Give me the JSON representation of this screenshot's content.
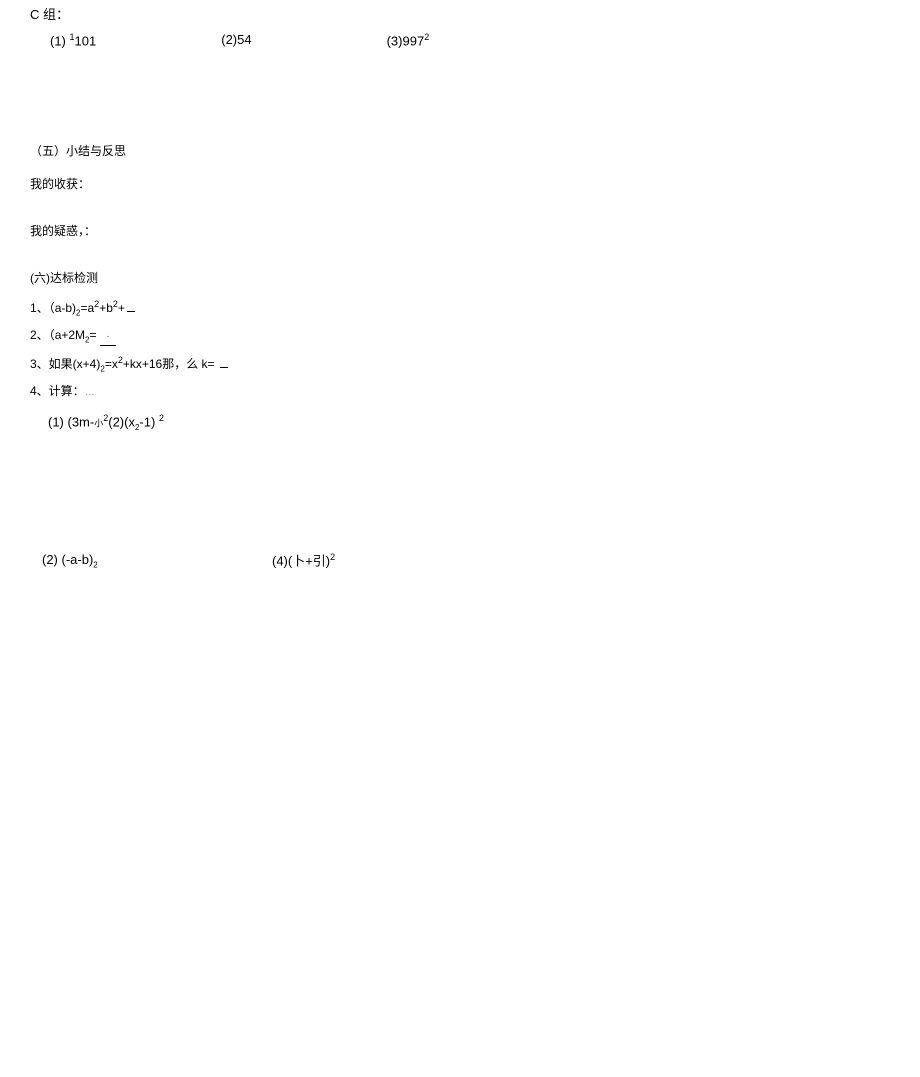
{
  "groupC": {
    "header": "C 组：",
    "items": [
      {
        "prefix": "(1)",
        "sup_before": "1",
        "body": "101"
      },
      {
        "prefix": "(2)",
        "body": "54"
      },
      {
        "prefix": "(3)",
        "body": "997",
        "sup_after": "2"
      }
    ]
  },
  "section5": {
    "heading": "（五）小结与反思",
    "harvest": "我的收获：",
    "doubt": "我的疑惑，："
  },
  "section6": {
    "heading": "(六)达标检测",
    "q1_prefix": "1、",
    "q1_expr_a": "（a-b)",
    "q1_sub": "2",
    "q1_expr_b": "=a",
    "q1_sup1": "2",
    "q1_expr_c": "+b",
    "q1_sup2": "2",
    "q1_expr_d": "+",
    "q2_prefix": "2、",
    "q2_expr": "（a+2M",
    "q2_sub": "2",
    "q2_eq": "=",
    "q2_blank": "·",
    "q3_prefix": "3、如果(x+4)",
    "q3_sub1": "2",
    "q3_mid": "=x",
    "q3_sup1": "2",
    "q3_mid2": "+kx+16",
    "q3_sub2": "",
    "q3_tail": "那，么 k=",
    "q4_prefix": "4、计算：",
    "q4_gray": "…",
    "expr1": {
      "prefix": "(1) (3m-",
      "small": "小",
      "sup1": "2",
      "mid": "(2)(x",
      "sub": "2",
      "tail": "-1)",
      "sup2": "2"
    },
    "expr2_left": {
      "prefix": "(2) (-a-b)",
      "sub": "2"
    },
    "expr2_right": {
      "prefix": "(4)(卜+引)",
      "sup": "2"
    }
  }
}
